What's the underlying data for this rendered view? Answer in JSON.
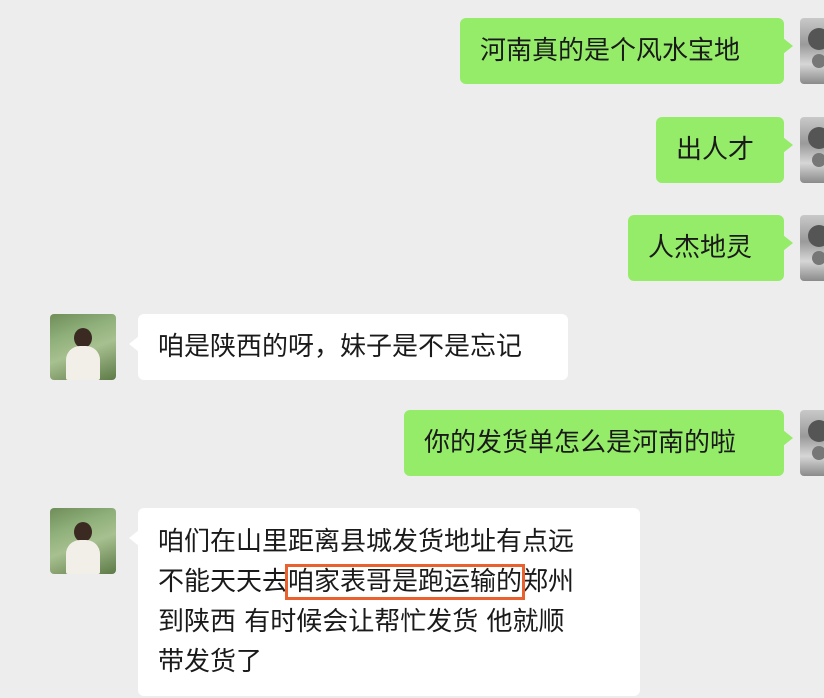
{
  "messages": [
    {
      "side": "self",
      "text": "河南真的是个风水宝地"
    },
    {
      "side": "self",
      "text": "出人才"
    },
    {
      "side": "self",
      "text": "人杰地灵"
    },
    {
      "side": "other",
      "text": "咱是陕西的呀，妹子是不是忘记"
    },
    {
      "side": "self",
      "text": "你的发货单怎么是河南的啦"
    },
    {
      "side": "other",
      "lines": {
        "l1": "咱们在山里距离县城发货地址有点远",
        "l2_pre": "不能天天去",
        "l2_highlight": "咱家表哥是跑运输的",
        "l2_post": "郑州",
        "l3": "到陕西  有时候会让帮忙发货  他就顺",
        "l4": "带发货了"
      }
    }
  ],
  "colors": {
    "background": "#ededed",
    "self_bubble": "#95ec69",
    "other_bubble": "#ffffff",
    "highlight_box": "#e8612e"
  },
  "icons": {
    "self_avatar": "avatar-self",
    "other_avatar": "avatar-other"
  }
}
